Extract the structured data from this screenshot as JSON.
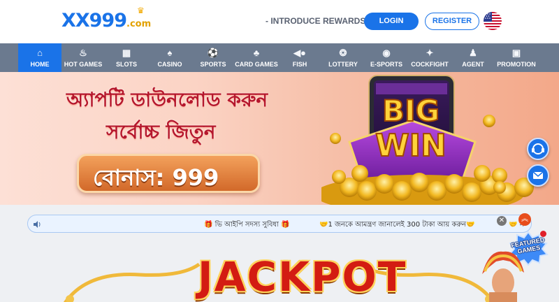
{
  "header": {
    "logo_main": "XX999",
    "logo_suffix": ".com",
    "introduce_rewards": "- INTRODUCE REWARDS",
    "login_label": "LOGIN",
    "register_label": "REGISTER",
    "language_icon": "us-flag-icon"
  },
  "nav": {
    "items": [
      {
        "label": "HOME",
        "icon": "home-icon",
        "active": true
      },
      {
        "label": "HOT GAMES",
        "icon": "flame-icon"
      },
      {
        "label": "SLOTS",
        "icon": "slot-machine-icon"
      },
      {
        "label": "CASINO",
        "icon": "dealer-icon"
      },
      {
        "label": "SPORTS",
        "icon": "sports-icon"
      },
      {
        "label": "CARD GAMES",
        "icon": "cards-icon"
      },
      {
        "label": "FISH",
        "icon": "fish-icon"
      },
      {
        "label": "LOTTERY",
        "icon": "lottery-icon"
      },
      {
        "label": "E-SPORTS",
        "icon": "gamepad-icon"
      },
      {
        "label": "COCKFIGHT",
        "icon": "rooster-icon"
      },
      {
        "label": "AGENT",
        "icon": "agent-icon"
      },
      {
        "label": "PROMOTION",
        "icon": "gift-icon"
      }
    ]
  },
  "banner": {
    "line1": "অ্যাপটি ডাউনলোড করুন",
    "line2": "সর্বোচ্চ জিতুন",
    "bonus": "বোনাস: 999",
    "big_win": "BIG WIN"
  },
  "ticker": {
    "message1": "🎁 ভি আইপি সদস্য সুবিধা 🎁",
    "message2": "🤝1 জনকে আমন্ত্রণ জানালেই 300 টাকা আয় করুন🤝",
    "message3_partial": "🤝 স"
  },
  "featured_games_label": "FEATURED GAMES",
  "jackpot_label": "JACKPOT",
  "colors": {
    "brand_blue": "#1a73e8",
    "nav_bg": "#6b7a8f",
    "jackpot_red": "#d31c12"
  }
}
